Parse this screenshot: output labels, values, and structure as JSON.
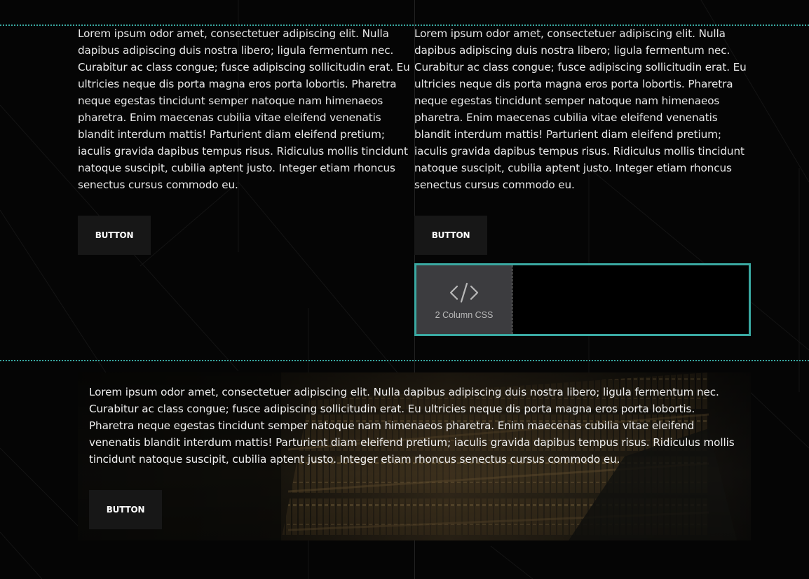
{
  "top_section": {
    "left_column": {
      "paragraph": "Lorem ipsum odor amet, consectetuer adipiscing elit. Nulla dapibus adipiscing duis nostra libero; ligula fermentum nec. Curabitur ac class congue; fusce adipiscing sollicitudin erat. Eu ultricies neque dis porta magna eros porta lobortis. Pharetra neque egestas tincidunt semper natoque nam himenaeos pharetra. Enim maecenas cubilia vitae eleifend venenatis blandit interdum mattis! Parturient diam eleifend pretium; iaculis gravida dapibus tempus risus. Ridiculus mollis tincidunt natoque suscipit, cubilia aptent justo. Integer etiam rhoncus senectus cursus commodo eu.",
      "button_label": "BUTTON"
    },
    "right_column": {
      "paragraph": "Lorem ipsum odor amet, consectetuer adipiscing elit. Nulla dapibus adipiscing duis nostra libero; ligula fermentum nec. Curabitur ac class congue; fusce adipiscing sollicitudin erat. Eu ultricies neque dis porta magna eros porta lobortis. Pharetra neque egestas tincidunt semper natoque nam himenaeos pharetra. Enim maecenas cubilia vitae eleifend venenatis blandit interdum mattis! Parturient diam eleifend pretium; iaculis gravida dapibus tempus risus. Ridiculus mollis tincidunt natoque suscipit, cubilia aptent justo. Integer etiam rhoncus senectus cursus commodo eu.",
      "button_label": "BUTTON"
    },
    "code_widget": {
      "icon": "code-icon",
      "label": "2 Column CSS"
    }
  },
  "bottom_section": {
    "paragraph": "Lorem ipsum odor amet, consectetuer adipiscing elit. Nulla dapibus adipiscing duis nostra libero; ligula fermentum nec. Curabitur ac class congue; fusce adipiscing sollicitudin erat. Eu ultricies neque dis porta magna eros porta lobortis. Pharetra neque egestas tincidunt semper natoque nam himenaeos pharetra. Enim maecenas cubilia vitae eleifend venenatis blandit interdum mattis! Parturient diam eleifend pretium; iaculis gravida dapibus tempus risus. Ridiculus mollis tincidunt natoque suscipit, cubilia aptent justo. Integer etiam rhoncus senectus cursus commodo eu.",
    "button_label": "BUTTON",
    "background_image": "library-bookshelves-image"
  },
  "colors": {
    "page_background": "#050505",
    "accent": "#3aa9a2",
    "button_background": "#171717",
    "widget_tab": "#3c3c3f"
  }
}
